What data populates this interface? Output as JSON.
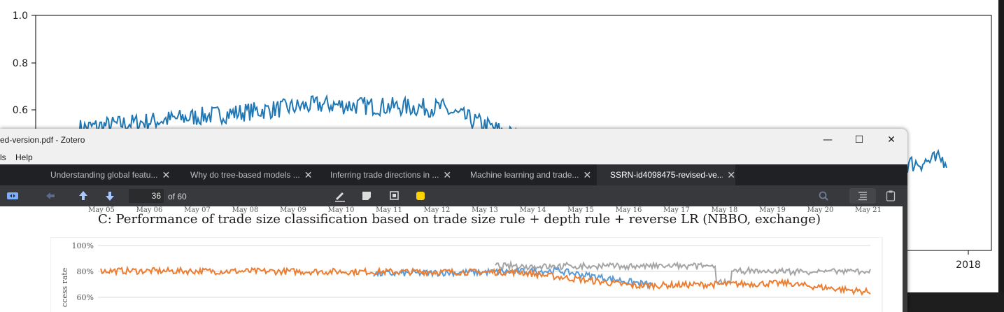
{
  "background_chart": {
    "y_ticks": [
      "1.0",
      "0.8",
      "0.6"
    ],
    "x_tick": "2018",
    "line_color": "#1f77b4"
  },
  "window": {
    "title": "ed-version.pdf - Zotero",
    "minimize_glyph": "—",
    "maximize_glyph": "☐",
    "close_glyph": "✕"
  },
  "menu": {
    "items": [
      "ls",
      "Help"
    ]
  },
  "tabs": [
    {
      "label": "Understanding global featu...",
      "active": false
    },
    {
      "label": "Why do tree-based models ...",
      "active": false
    },
    {
      "label": "Inferring trade directions in ...",
      "active": false
    },
    {
      "label": "Machine learning and trade...",
      "active": false
    },
    {
      "label": "SSRN-id4098475-revised-ve...",
      "active": true
    }
  ],
  "toolbar": {
    "page_current": "36",
    "page_total": "of 60",
    "icons": [
      "sidebar-toggle-icon",
      "back-arrow-icon",
      "up-arrow-icon",
      "down-arrow-icon",
      "pen-icon",
      "note-icon",
      "area-select-icon",
      "highlight-color-icon",
      "search-icon",
      "outline-icon",
      "notes-pane-icon"
    ],
    "highlight_color": "#ffd400"
  },
  "document": {
    "top_ticks": [
      "May 05",
      "May 06",
      "May 07",
      "May 08",
      "May 09",
      "May 10",
      "May 11",
      "May 12",
      "May 13",
      "May 14",
      "May 15",
      "May 16",
      "May 17",
      "May 18",
      "May 19",
      "May 20",
      "May 21"
    ],
    "heading": "C: Performance of trade size classification based on trade size rule + depth rule + reverse LR (NBBO, exchange)",
    "y_ticks": [
      "100%",
      "80%",
      "60%"
    ],
    "y_label": "ccess rate",
    "series_colors": {
      "orange": "#ed7d31",
      "blue": "#5b9bd5",
      "gray": "#a5a5a5"
    }
  }
}
